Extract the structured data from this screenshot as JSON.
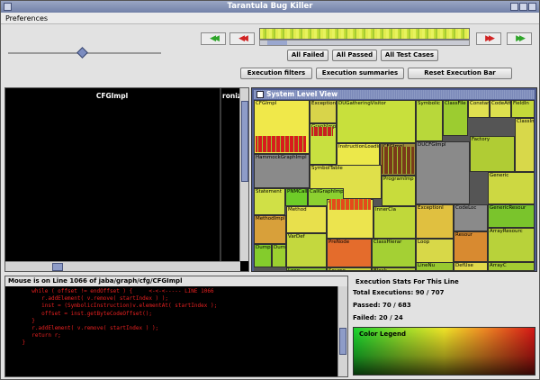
{
  "window": {
    "title": "Tarantula Bug Killer"
  },
  "menu": {
    "preferences": "Preferences"
  },
  "nav": {
    "first": "◀◀",
    "prev": "◀◀",
    "next": "▶▶",
    "last": "▶▶"
  },
  "buttons": {
    "all_failed": "All Failed",
    "all_passed": "All Passed",
    "all_test_cases": "All Test Cases",
    "execution_filters": "Execution filters",
    "execution_summaries": "Execution summaries",
    "reset_execution_bar": "Reset Execution Bar"
  },
  "cfg": {
    "title": "CFGImpl",
    "title2": "ronize"
  },
  "system_view": {
    "title": "System Level View",
    "labels": [
      "CFGImpl",
      "ExceptionTypes",
      "DUGatheringVisitor",
      "Symbolic",
      "ClassFile",
      "Constan",
      "CodeAtt",
      "FieldIn",
      "HammockGraphImpl",
      "GraphImpl",
      "InstructionLoadingVisitor",
      "ICFGImpl",
      "DUCFGImpl",
      "Factory",
      "SymbolTable",
      "ProgramImp",
      "Statement",
      "PNMCallGraph",
      "CallGraphImpl",
      "MethodImpl",
      "ClassImpl",
      "Method",
      "Constan",
      "InnerCla",
      "ExceptionI",
      "CodeLoc",
      "Generic",
      "GenericResour",
      "Resour",
      "ArrayResourc",
      "Dump",
      "Dum",
      "VarDef",
      "PreNode",
      "ClassHierar",
      "Loop",
      "Loop",
      "Source",
      "Block",
      "LineNu",
      "DefUse",
      "ArrayC"
    ]
  },
  "code": {
    "status": "Mouse is on Line 1066 of jaba/graph/cfg/CFGImpl",
    "lines": [
      "       while ( offset != endOffset ) {     <-<-<----- LINE 1066",
      "          r.addElement( v.remove( startIndex ) );",
      "          inst = (SymbolicInstruction)v.elementAt( startIndex );",
      "          offset = inst.getByteCodeOffset();",
      "       }",
      "       r.addElement( v.remove( startIndex ) );",
      "       return r;",
      "    }"
    ]
  },
  "stats": {
    "title": "Execution Stats For This Line",
    "total": "Total Executions: 90 / 707",
    "passed": "Passed: 70 / 683",
    "failed": "Failed: 20 / 24",
    "legend": "Color Legend"
  },
  "colors": {
    "accent": "#4f5c90",
    "pass": "#2fa52a",
    "fail": "#d12424"
  }
}
